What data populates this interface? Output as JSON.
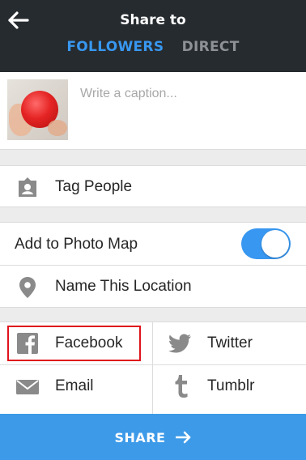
{
  "header": {
    "title": "Share to",
    "back_icon": "arrow-left-icon",
    "tabs": [
      {
        "label": "FOLLOWERS",
        "active": true
      },
      {
        "label": "DIRECT",
        "active": false
      }
    ]
  },
  "caption": {
    "placeholder": "Write a caption..."
  },
  "tag_people": {
    "label": "Tag People",
    "icon": "tag-person-icon"
  },
  "photo_map": {
    "label": "Add to Photo Map",
    "toggle_on": true
  },
  "location": {
    "label": "Name This Location",
    "icon": "location-pin-icon"
  },
  "share_targets": [
    {
      "label": "Facebook",
      "icon": "facebook-icon"
    },
    {
      "label": "Twitter",
      "icon": "twitter-icon"
    },
    {
      "label": "Email",
      "icon": "mail-icon"
    },
    {
      "label": "Tumblr",
      "icon": "tumblr-icon"
    }
  ],
  "share_button": {
    "label": "SHARE",
    "icon": "arrow-right-icon"
  },
  "colors": {
    "header_bg": "#262b2f",
    "accent": "#3897f0",
    "share_bar": "#3d9ae8",
    "highlight": "#e0121b",
    "icon_gray": "#8a8a8a"
  }
}
